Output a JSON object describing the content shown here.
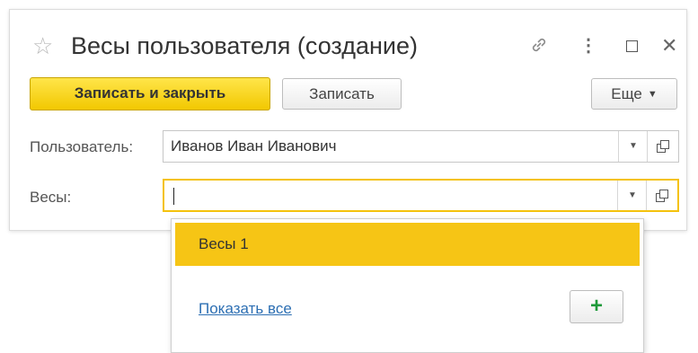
{
  "window": {
    "title": "Весы пользователя (создание)",
    "icons": {
      "favorite": "star-icon",
      "link": "link-icon",
      "more": "more-vertical-icon",
      "restore": "restore-window-icon",
      "close": "close-icon"
    }
  },
  "toolbar": {
    "save_close_label": "Записать и закрыть",
    "save_label": "Записать",
    "more_label": "Еще"
  },
  "form": {
    "user": {
      "label": "Пользователь:",
      "value": "Иванов Иван Иванович"
    },
    "scales": {
      "label": "Весы:",
      "value": ""
    }
  },
  "dropdown": {
    "items": [
      {
        "label": "Весы 1"
      }
    ],
    "show_all_label": "Показать все",
    "add_symbol": "+"
  },
  "colors": {
    "accent": "#f4c20d",
    "primary_button": "#f2c800",
    "link": "#2d6fb3",
    "add_icon": "#1f9a3a"
  }
}
